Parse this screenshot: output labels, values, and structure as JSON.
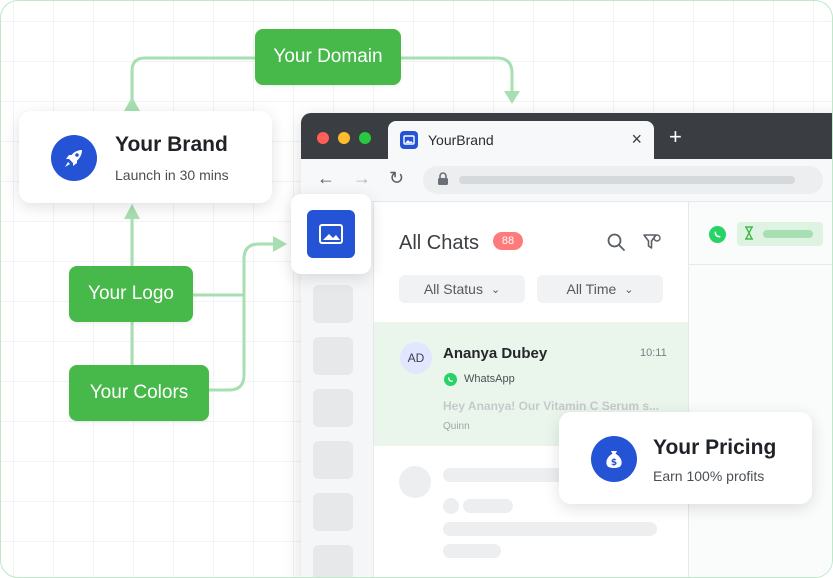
{
  "nodes": {
    "domain_label": "Your Domain",
    "logo_label": "Your Logo",
    "colors_label": "Your Colors"
  },
  "brand_card": {
    "title": "Your Brand",
    "subtitle": "Launch in 30 mins",
    "icon": "rocket-icon"
  },
  "pricing_card": {
    "title": "Your Pricing",
    "subtitle": "Earn 100% profits",
    "icon": "money-bag-icon"
  },
  "browser": {
    "tab_title": "YourBrand",
    "tab_close": "×",
    "new_tab": "+"
  },
  "chats": {
    "title": "All Chats",
    "count": "88",
    "filter_status": "All Status",
    "filter_time": "All Time",
    "active_chat": {
      "initials": "AD",
      "name": "Ananya Dubey",
      "time": "10:11",
      "channel": "WhatsApp",
      "preview": "Hey Ananya! Our Vitamin C Serum s...",
      "agent": "Quinn"
    }
  },
  "colors": {
    "accent_green": "#46b94a",
    "brand_blue": "#2453d6",
    "badge_red": "#ff7a7a"
  }
}
